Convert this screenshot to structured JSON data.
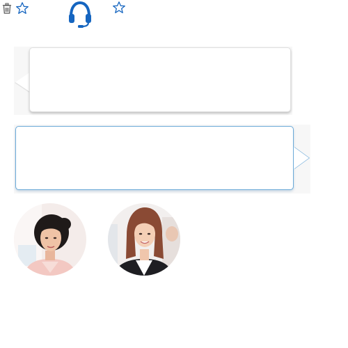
{
  "toolbar": {
    "icons": [
      "trash-icon",
      "star-icon",
      "headset-icon",
      "star-icon"
    ],
    "accent_color": "#1565c0"
  },
  "messages": [
    {
      "side": "left",
      "text": ""
    },
    {
      "side": "right",
      "text": ""
    }
  ],
  "avatars": [
    {
      "id": "avatar-1"
    },
    {
      "id": "avatar-2"
    }
  ],
  "colors": {
    "background": "#ffffff",
    "bubble_border_left": "#e0e0e0",
    "bubble_border_right": "#6aa9d8",
    "bubble_panel": "#f7f7f7"
  }
}
